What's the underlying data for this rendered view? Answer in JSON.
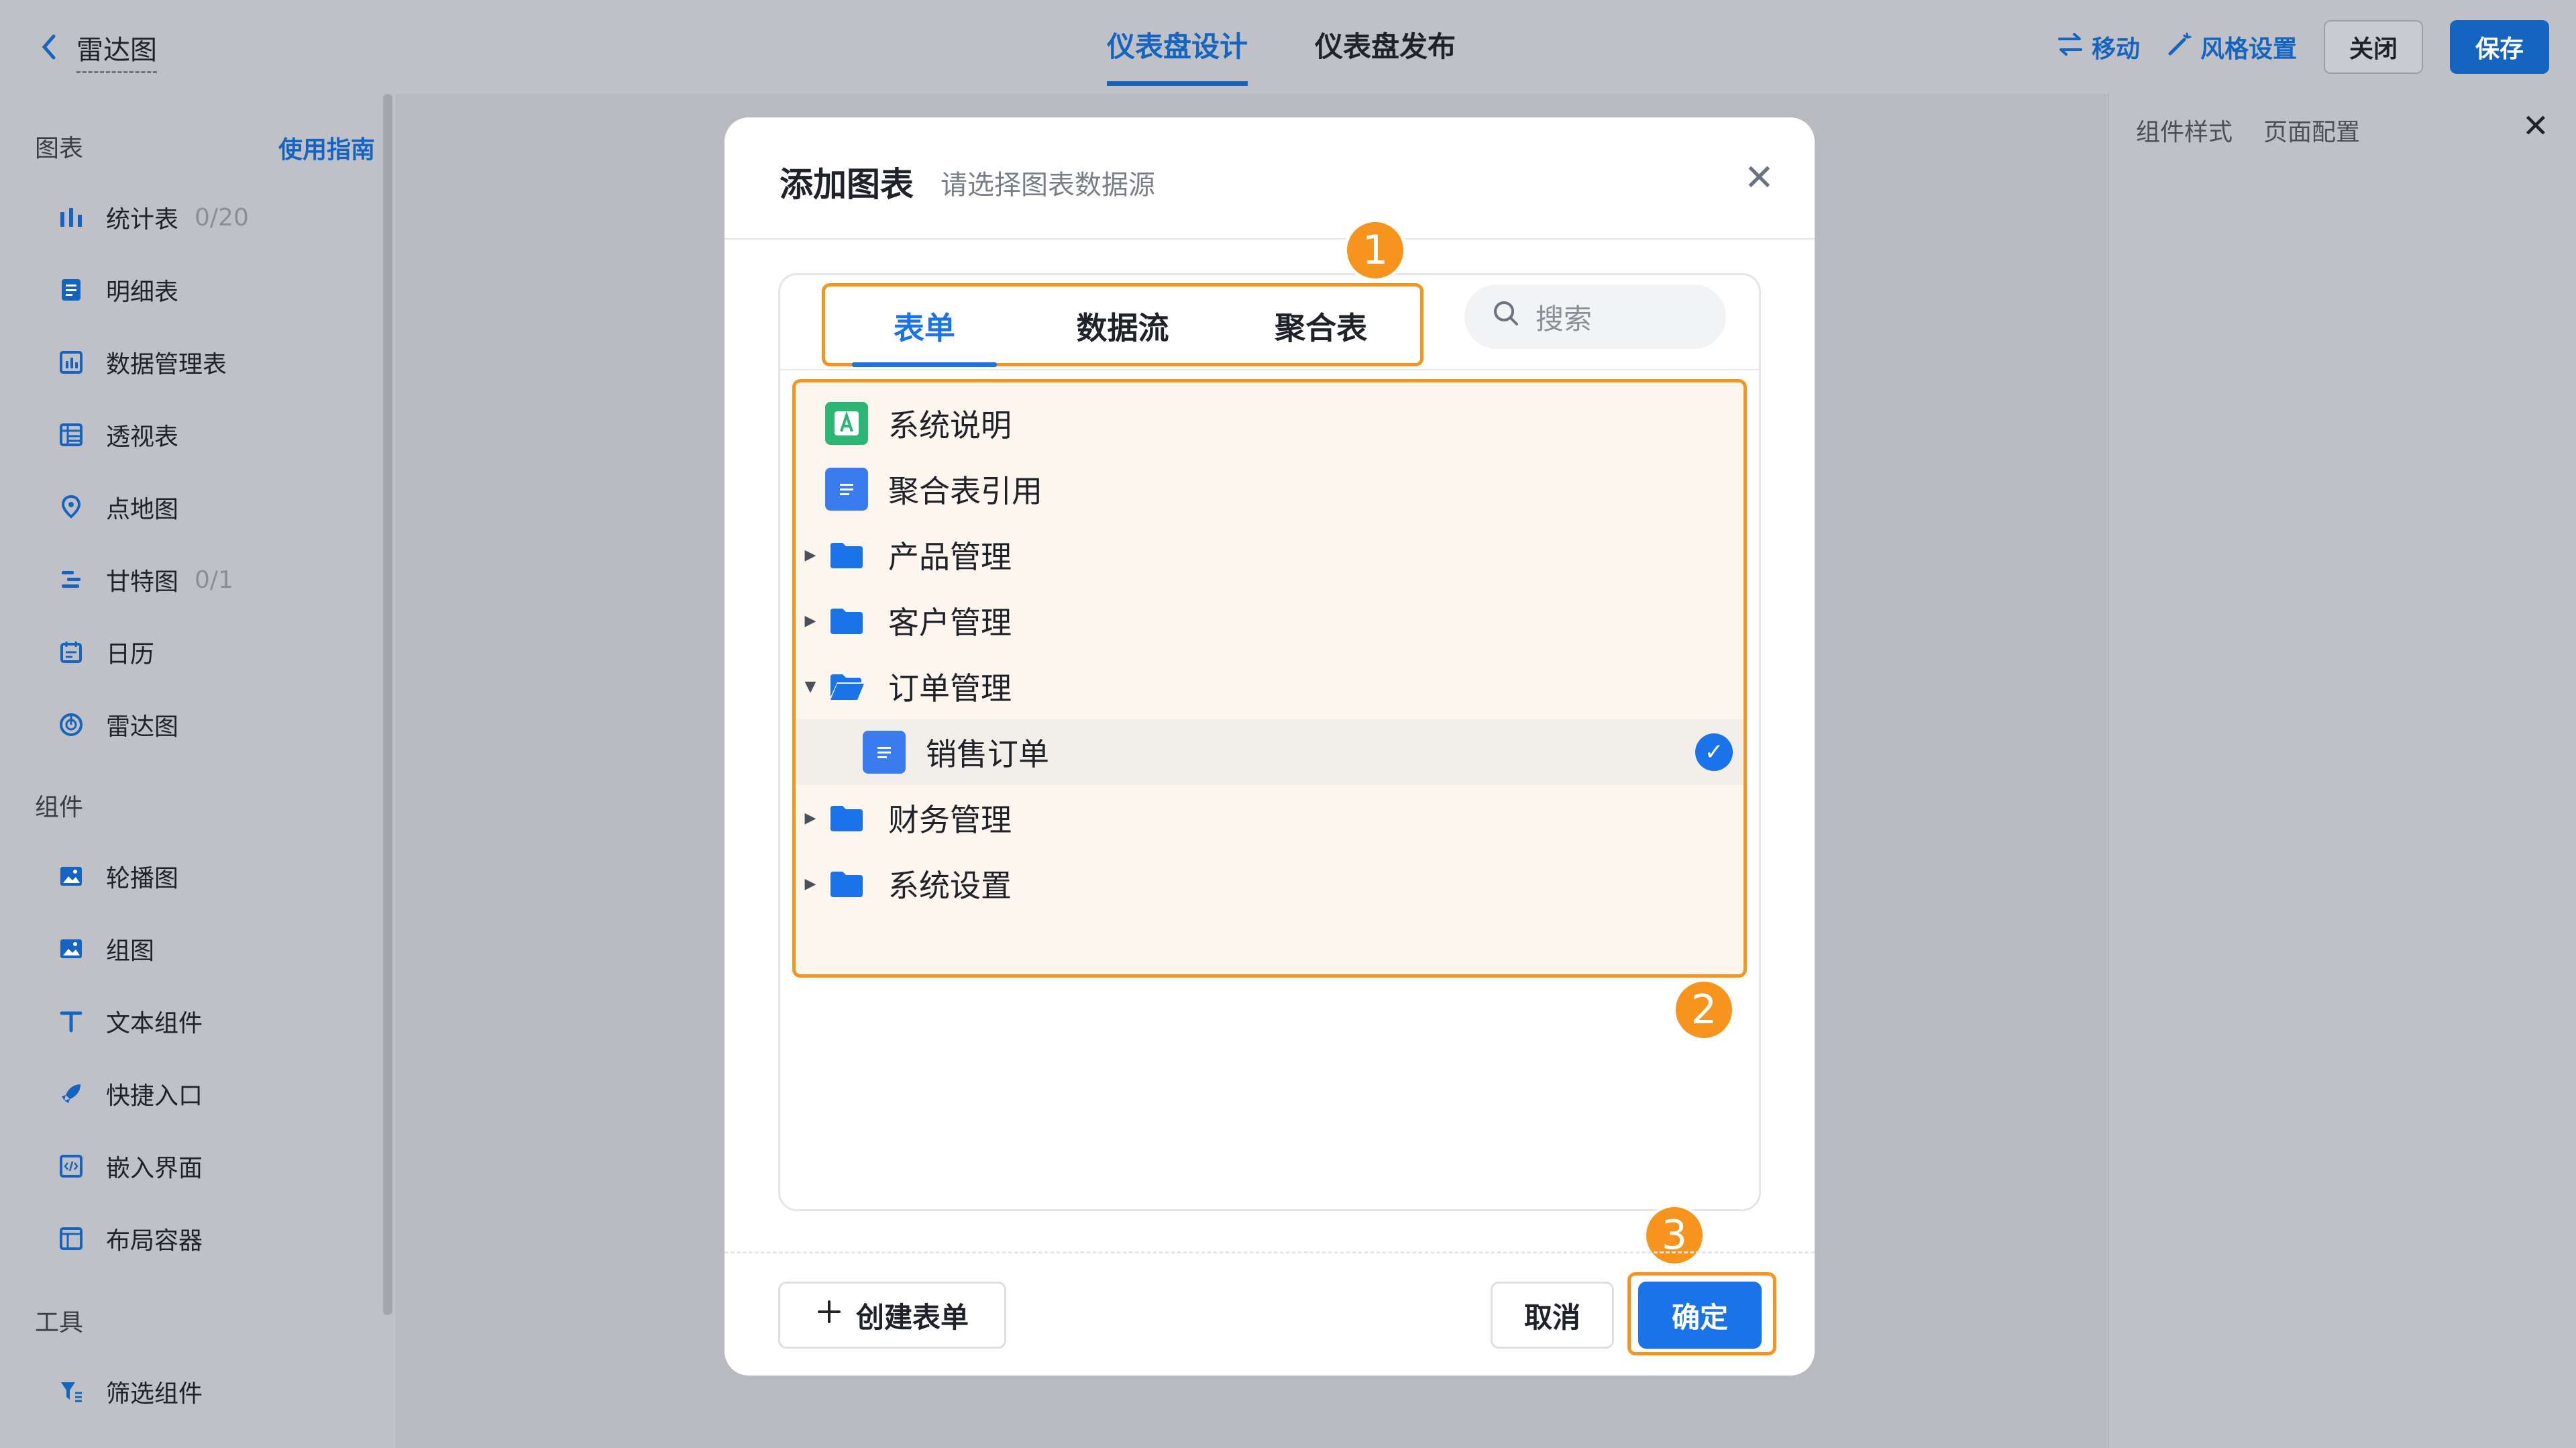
{
  "header": {
    "back_title": "雷达图",
    "tabs": [
      "仪表盘设计",
      "仪表盘发布"
    ],
    "move_label": "移动",
    "style_label": "风格设置",
    "close_label": "关闭",
    "save_label": "保存"
  },
  "sidebar": {
    "charts_title": "图表",
    "guide_label": "使用指南",
    "charts": [
      {
        "label": "统计表",
        "count": "0/20",
        "icon": "bar-chart-icon"
      },
      {
        "label": "明细表",
        "count": "",
        "icon": "list-doc-icon"
      },
      {
        "label": "数据管理表",
        "count": "",
        "icon": "data-table-icon"
      },
      {
        "label": "透视表",
        "count": "",
        "icon": "pivot-table-icon"
      },
      {
        "label": "点地图",
        "count": "",
        "icon": "map-pin-icon"
      },
      {
        "label": "甘特图",
        "count": "0/1",
        "icon": "gantt-icon"
      },
      {
        "label": "日历",
        "count": "",
        "icon": "calendar-icon"
      },
      {
        "label": "雷达图",
        "count": "",
        "icon": "radar-icon"
      }
    ],
    "components_title": "组件",
    "components": [
      {
        "label": "轮播图",
        "icon": "carousel-icon"
      },
      {
        "label": "组图",
        "icon": "image-group-icon"
      },
      {
        "label": "文本组件",
        "icon": "text-icon"
      },
      {
        "label": "快捷入口",
        "icon": "rocket-icon"
      },
      {
        "label": "嵌入界面",
        "icon": "embed-icon"
      },
      {
        "label": "布局容器",
        "icon": "layout-icon"
      }
    ],
    "tools_title": "工具",
    "tools": [
      {
        "label": "筛选组件",
        "icon": "filter-icon"
      }
    ]
  },
  "right_panel": {
    "tabs": [
      "组件样式",
      "页面配置"
    ]
  },
  "modal": {
    "title": "添加图表",
    "subtitle": "请选择图表数据源",
    "tabs": [
      "表单",
      "数据流",
      "聚合表"
    ],
    "search_placeholder": "搜索",
    "tree": [
      {
        "label": "系统说明",
        "type": "app",
        "caret": ""
      },
      {
        "label": "聚合表引用",
        "type": "doc",
        "caret": ""
      },
      {
        "label": "产品管理",
        "type": "folder",
        "caret": "▶"
      },
      {
        "label": "客户管理",
        "type": "folder",
        "caret": "▶"
      },
      {
        "label": "订单管理",
        "type": "folder-open",
        "caret": "▼"
      },
      {
        "label": "销售订单",
        "type": "doc",
        "caret": "",
        "selected": true
      },
      {
        "label": "财务管理",
        "type": "folder",
        "caret": "▶"
      },
      {
        "label": "系统设置",
        "type": "folder",
        "caret": "▶"
      }
    ],
    "create_label": "创建表单",
    "cancel_label": "取消",
    "ok_label": "确定",
    "badges": [
      "1",
      "2",
      "3"
    ]
  },
  "colors": {
    "accent": "#1a73e8",
    "highlight": "#f7941d"
  }
}
